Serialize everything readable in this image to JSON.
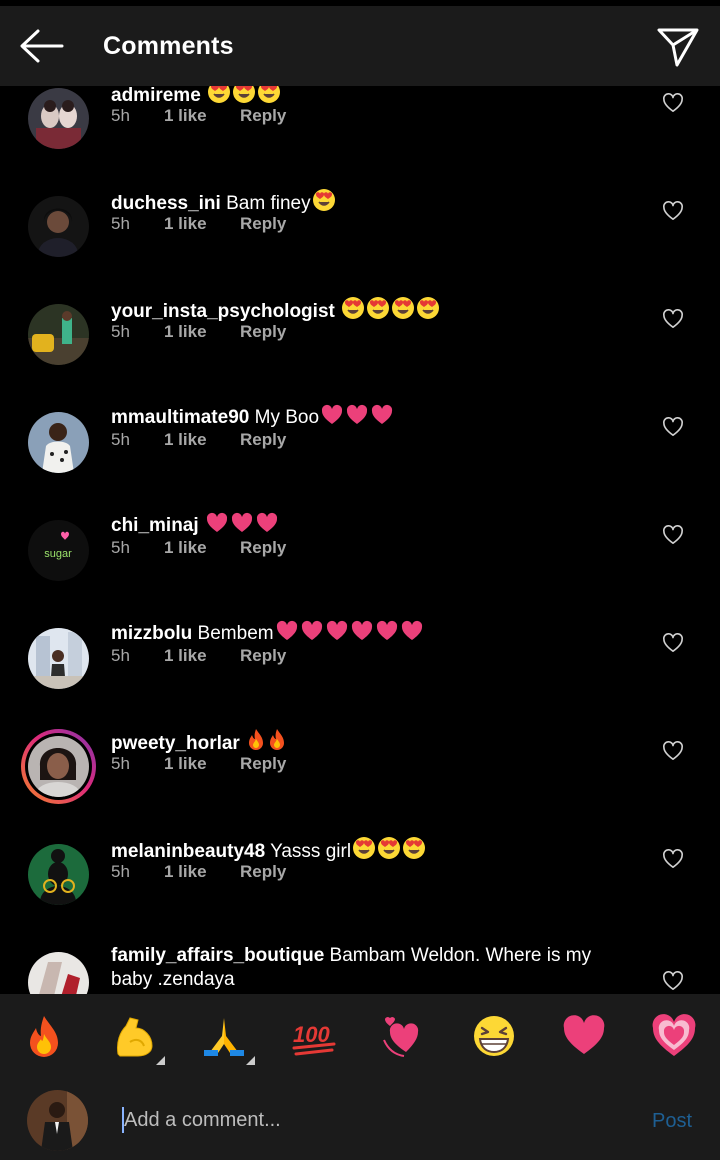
{
  "header": {
    "title": "Comments"
  },
  "action_labels": {
    "like": "1 like",
    "reply": "Reply"
  },
  "comments": [
    {
      "username": "admireme",
      "text": "",
      "emoji": "heart-eyes",
      "emoji_count": 3,
      "time": "5h"
    },
    {
      "username": "duchess_ini",
      "text": " Bam finey",
      "emoji": "heart-eyes",
      "emoji_count": 1,
      "time": "5h"
    },
    {
      "username": "your_insta_psychologist",
      "text": "",
      "emoji": "heart-eyes",
      "emoji_count": 4,
      "time": "5h"
    },
    {
      "username": "mmaultimate90",
      "text": " My Boo",
      "emoji": "pink-heart",
      "emoji_count": 3,
      "time": "5h"
    },
    {
      "username": "chi_minaj",
      "text": "",
      "emoji": "pink-heart",
      "emoji_count": 3,
      "time": "5h",
      "avatar_text": "sugar"
    },
    {
      "username": "mizzbolu",
      "text": " Bembem",
      "emoji": "pink-heart",
      "emoji_count": 6,
      "time": "5h"
    },
    {
      "username": "pweety_horlar",
      "text": "",
      "emoji": "fire",
      "emoji_count": 2,
      "time": "5h"
    },
    {
      "username": "melaninbeauty48",
      "text": " Yasss girl",
      "emoji": "heart-eyes",
      "emoji_count": 3,
      "time": "5h"
    },
    {
      "username": "family_affairs_boutique",
      "text": " Bambam Weldon. Where is my",
      "text_line2": "baby .zendaya"
    }
  ],
  "emoji_bar": [
    "fire",
    "flexed-biceps",
    "folded-hands",
    "hundred-points",
    "revolving-hearts",
    "grinning-squinting-face",
    "red-heart",
    "sparkling-heart"
  ],
  "composer": {
    "placeholder": "Add a comment...",
    "post_label": "Post"
  },
  "colors": {
    "header_bg": "#1b1b1b",
    "background": "#000000",
    "muted_text": "#a8a8a8",
    "post_disabled": "#1e5f93",
    "story_ring": "#dd2a7b"
  }
}
